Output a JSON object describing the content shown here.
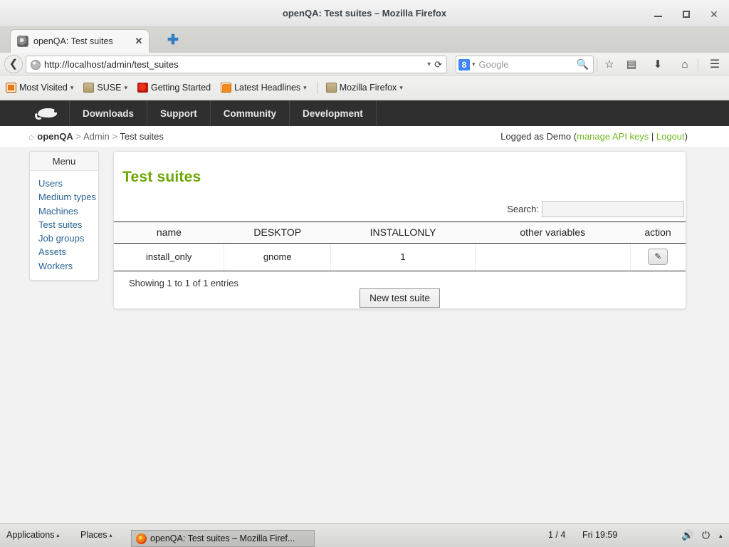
{
  "window": {
    "title": "openQA: Test suites – Mozilla Firefox",
    "minimize_label": "–",
    "maximize_label": "□",
    "close_label": "✕"
  },
  "tabs": [
    {
      "title": "openQA: Test suites",
      "favicon": "openqa-favicon",
      "close_label": "✕"
    }
  ],
  "newtab_label": "✚",
  "urlbar": {
    "back_label": "❮",
    "url": "http://localhost/admin/test_suites",
    "dropdown_label": "▾",
    "reload_label": "⟳",
    "page_icon": "globe-icon"
  },
  "searchbar": {
    "engine_label": "8",
    "dropdown_label": "▾",
    "placeholder": "Google",
    "magnifier_label": "🔍"
  },
  "nav_icons": [
    {
      "name": "bookmark-star-icon",
      "glyph": "☆"
    },
    {
      "name": "library-icon",
      "glyph": "▤"
    },
    {
      "name": "downloads-icon",
      "glyph": "⬇"
    },
    {
      "name": "home-icon",
      "glyph": "⌂"
    },
    {
      "name": "hamburger-menu-icon",
      "glyph": "☰"
    }
  ],
  "bookmarks": [
    {
      "label": "Most Visited",
      "icon": "most-visited-icon",
      "caret": "▾"
    },
    {
      "label": "SUSE",
      "icon": "folder-icon",
      "caret": "▾"
    },
    {
      "label": "Getting Started",
      "icon": "firefox-icon",
      "caret": ""
    },
    {
      "label": "Latest Headlines",
      "icon": "rss-icon",
      "caret": "▾"
    },
    {
      "label": "Mozilla Firefox",
      "icon": "folder-icon",
      "caret": "▾"
    }
  ],
  "site_nav": {
    "logo": "opensuse-chameleon-logo",
    "items": [
      {
        "label": "Downloads"
      },
      {
        "label": "Support"
      },
      {
        "label": "Community"
      },
      {
        "label": "Development"
      }
    ]
  },
  "breadcrumb": {
    "home_icon": "⌂",
    "root": "openQA",
    "sep": ">",
    "middle": "Admin",
    "current": "Test suites"
  },
  "session": {
    "text_before": "Logged as Demo (",
    "manage_keys": "manage API keys",
    "divider": " | ",
    "logout": "Logout",
    "text_after": ")",
    "link_color": "#73ba25"
  },
  "sidebar": {
    "heading": "Menu",
    "items": [
      {
        "label": "Users"
      },
      {
        "label": "Medium types"
      },
      {
        "label": "Machines"
      },
      {
        "label": "Test suites"
      },
      {
        "label": "Job groups"
      },
      {
        "label": "Assets"
      },
      {
        "label": "Workers"
      }
    ]
  },
  "main": {
    "title": "Test suites",
    "title_color": "#6ca600",
    "search_label": "Search:",
    "search_value": "",
    "table": {
      "columns": [
        "name",
        "DESKTOP",
        "INSTALLONLY",
        "other variables",
        "action"
      ],
      "rows": [
        {
          "name": "install_only",
          "desktop": "gnome",
          "installonly": "1",
          "other_variables": "",
          "action_icon": "edit-pencil-icon",
          "action_glyph": "✎"
        }
      ]
    },
    "showing_text": "Showing 1 to 1 of 1 entries",
    "new_button": "New test suite"
  },
  "taskbar": {
    "applications": "Applications",
    "applications_caret": "▴",
    "places": "Places",
    "places_caret": "▴",
    "window_item": "openQA: Test suites – Mozilla Firef...",
    "workspace": "1 / 4",
    "clock": "Fri 19:59",
    "volume_icon": "🔊",
    "power_icon": "⏻",
    "expand_icon": "▴"
  }
}
